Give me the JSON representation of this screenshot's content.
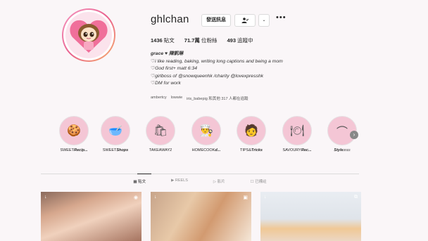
{
  "profile": {
    "username": "ghlchan",
    "message_button": "發送訊息",
    "stats": {
      "posts_count": "1436",
      "posts_label": "貼文",
      "followers_count": "71.7萬",
      "followers_label": "位粉絲",
      "following_count": "493",
      "following_label": "追蹤中"
    },
    "bio": {
      "name": "grace ♥ 陳凱琳",
      "lines": [
        "♡i like reading, baking, writing long captions and being a mom",
        "♡God first+ matt 6:34",
        "♡girlboss of @snowqueenhk /charity @lovexpresshk",
        "♡DM for work"
      ]
    },
    "followed_by": [
      "ambertcy",
      "lowwie",
      "iris_babepig 和其他 317 人都在追蹤"
    ]
  },
  "highlights": [
    {
      "icon": "cookie-icon",
      "glyph": "🍪",
      "label_plain": "SWEET",
      "label_bold": "Recip..."
    },
    {
      "icon": "mixer-icon",
      "glyph": "🥣",
      "label_plain": "SWEET",
      "label_bold": "Shops"
    },
    {
      "icon": "takeaway-bag-icon",
      "glyph": "🛍",
      "label_plain": "TAKEAWAY2",
      "label_bold": ""
    },
    {
      "icon": "chef-hat-icon",
      "glyph": "👨‍🍳",
      "label_plain": "HOMECOOK",
      "label_bold": "d..."
    },
    {
      "icon": "chef-avatar-icon",
      "glyph": "🧑",
      "label_plain": "TIPS&",
      "label_bold": "Tricks"
    },
    {
      "icon": "cloche-icon",
      "glyph": "🍽",
      "label_plain": "SAVOURY",
      "label_bold": "Rec..."
    },
    {
      "icon": "hanger-icon",
      "glyph": "⌒",
      "label_plain": "",
      "label_bold": "Style",
      "label_suffix": "2022"
    }
  ],
  "tabs": [
    {
      "icon": "grid-icon",
      "glyph": "▦",
      "label": "貼文",
      "active": true
    },
    {
      "icon": "reels-icon",
      "glyph": "▶",
      "label": "REELS",
      "active": false
    },
    {
      "icon": "video-icon",
      "glyph": "▷",
      "label": "影片",
      "active": false
    },
    {
      "icon": "tagged-icon",
      "glyph": "☐",
      "label": "已標註",
      "active": false
    }
  ],
  "colors": {
    "accent_pink": "#f4c6d5",
    "avatar_ring": "#e9608e",
    "background": "#faf6f8"
  }
}
